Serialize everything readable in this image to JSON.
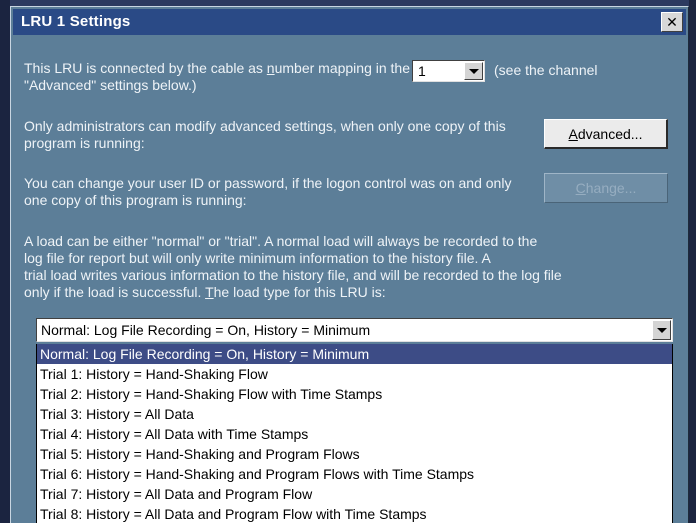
{
  "window": {
    "title": "LRU 1 Settings"
  },
  "cable": {
    "text_before": "This LRU is connected by the cable as ",
    "underlined": "n",
    "text_after": "umber mapping in the \"Advanced\" settings below.)",
    "selected_number": "1",
    "note": "(see the channel"
  },
  "advanced": {
    "text": "Only administrators can modify advanced settings, when only one copy of this program is running:",
    "button_underlined": "A",
    "button_rest": "dvanced..."
  },
  "change": {
    "text": "You can change your user ID or password, if the logon control was on and only one copy of this program is running:",
    "button_underlined": "C",
    "button_rest": "hange..."
  },
  "load": {
    "line1": "A load can be either \"normal\" or \"trial\".  A normal load will always be recorded to the",
    "line2": "log file for report but will only write minimum information to the history file.  A",
    "line3": "trial load writes various information to the history file, and will be recorded to the log file",
    "line4_before": "only if the load is successful.  ",
    "line4_underlined": "T",
    "line4_after": "he load type for this LRU is:",
    "selected": "Normal: Log File Recording = On, History = Minimum",
    "options": [
      "Normal: Log File Recording = On, History = Minimum",
      "Trial 1: History = Hand-Shaking Flow",
      "Trial 2: History = Hand-Shaking Flow with Time Stamps",
      "Trial 3: History = All Data",
      "Trial 4: History = All Data with Time Stamps",
      "Trial 5: History = Hand-Shaking and Program Flows",
      "Trial 6: History = Hand-Shaking and Program Flows with Time Stamps",
      "Trial 7: History = All Data and Program Flow",
      "Trial 8: History = All Data and Program Flow with Time Stamps"
    ]
  },
  "icons": {
    "close": "close-icon",
    "dropdown": "chevron-down-icon"
  },
  "colors": {
    "dialog": "#5c7e98",
    "titlebar": "#2a4a86",
    "selection": "#3d4c86"
  }
}
